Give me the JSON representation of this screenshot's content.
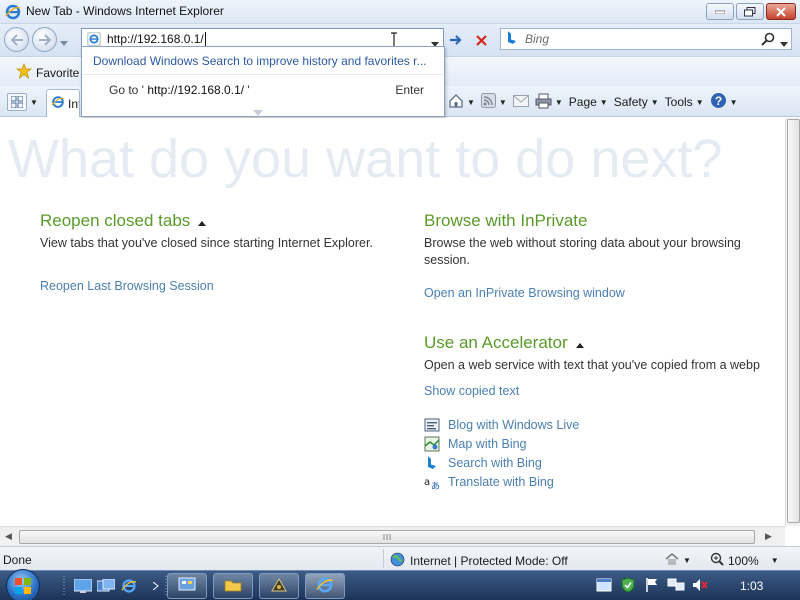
{
  "window": {
    "title": "New Tab - Windows Internet Explorer"
  },
  "navbar": {
    "address_value": "http://192.168.0.1/",
    "search_placeholder": "Bing"
  },
  "autocomplete": {
    "hint": "Download Windows Search to improve history and favorites r...",
    "goto_prefix": "Go to '",
    "goto_url": "http://192.168.0.1/",
    "goto_suffix": "'",
    "enter_label": "Enter"
  },
  "favorites": {
    "label": "Favorite"
  },
  "tab": {
    "label": "Int"
  },
  "commandbar": {
    "page_label": "Page",
    "safety_label": "Safety",
    "tools_label": "Tools"
  },
  "content": {
    "hero": "What do you want to do next?",
    "reopen": {
      "title": "Reopen closed tabs",
      "desc": "View tabs that you've closed since starting Internet Explorer.",
      "link": "Reopen Last Browsing Session"
    },
    "inprivate": {
      "title": "Browse with InPrivate",
      "desc": "Browse the web without storing data about your browsing session.",
      "link": "Open an InPrivate Browsing window"
    },
    "accelerator": {
      "title": "Use an Accelerator",
      "desc": "Open a web service with text that you've copied from a webp",
      "link": "Show copied text",
      "items": [
        {
          "label": "Blog with Windows Live",
          "icon": "blog-icon"
        },
        {
          "label": "Map with Bing",
          "icon": "map-icon"
        },
        {
          "label": "Search with Bing",
          "icon": "bing-icon"
        },
        {
          "label": "Translate with Bing",
          "icon": "translate-icon"
        }
      ]
    }
  },
  "statusbar": {
    "status": "Done",
    "zone": "Internet | Protected Mode: Off",
    "zoom": "100%"
  },
  "taskbar": {
    "clock": "1:03"
  },
  "colors": {
    "link": "#4a7fb0",
    "heading": "#5a9a2a",
    "hero": "#e6ebf3"
  }
}
